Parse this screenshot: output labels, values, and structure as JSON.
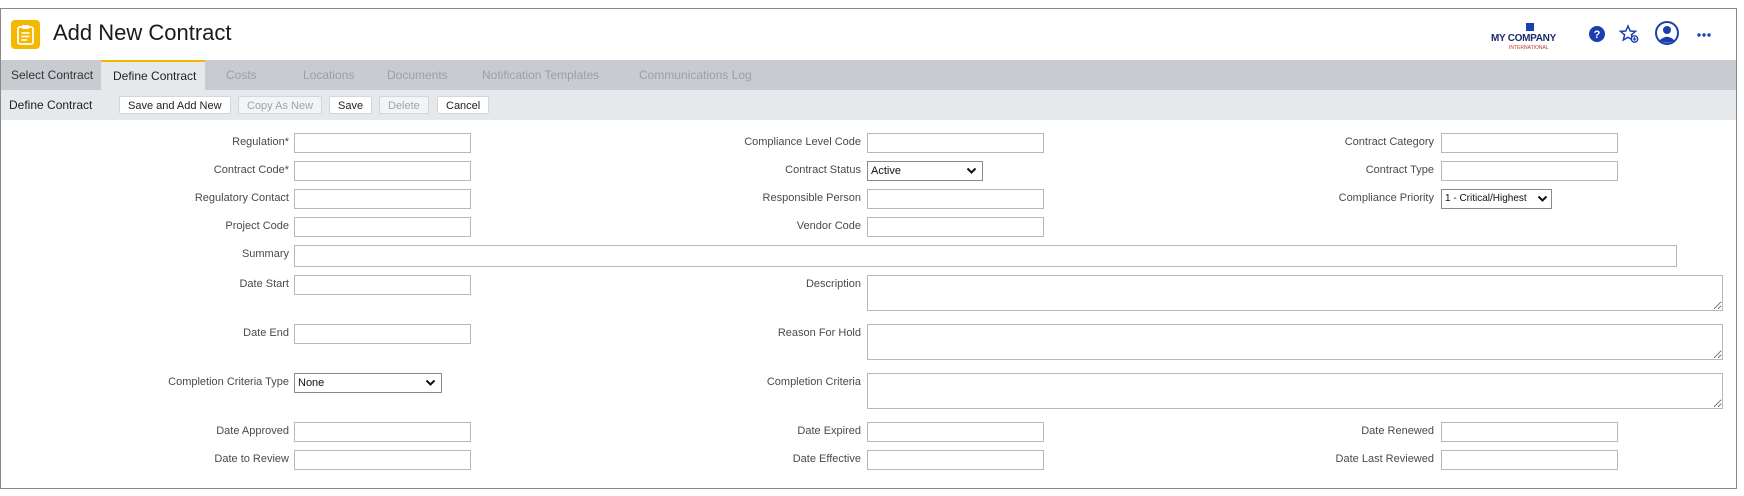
{
  "header": {
    "title": "Add New Contract",
    "app_icon": "clipboard-icon",
    "brand": {
      "name": "MY COMPANY",
      "subtitle": "INTERNATIONAL"
    },
    "icons": [
      "help-icon",
      "favorites-star-icon",
      "user-avatar-icon",
      "more-options-icon"
    ]
  },
  "tabs": [
    {
      "label": "Select Contract",
      "state": "enabled"
    },
    {
      "label": "Define Contract",
      "state": "active"
    },
    {
      "label": "Costs",
      "state": "disabled"
    },
    {
      "label": "Locations",
      "state": "disabled"
    },
    {
      "label": "Documents",
      "state": "disabled"
    },
    {
      "label": "Notification Templates",
      "state": "disabled"
    },
    {
      "label": "Communications Log",
      "state": "disabled"
    }
  ],
  "toolbar": {
    "label": "Define Contract",
    "save_and_add_new": "Save and Add New",
    "copy_as_new": "Copy As New",
    "save": "Save",
    "delete": "Delete",
    "cancel": "Cancel"
  },
  "form": {
    "regulation": {
      "label": "Regulation*",
      "value": ""
    },
    "contract_code": {
      "label": "Contract Code*",
      "value": ""
    },
    "regulatory_contact": {
      "label": "Regulatory Contact",
      "value": ""
    },
    "project_code": {
      "label": "Project Code",
      "value": ""
    },
    "summary": {
      "label": "Summary",
      "value": ""
    },
    "date_start": {
      "label": "Date Start",
      "value": ""
    },
    "date_end": {
      "label": "Date End",
      "value": ""
    },
    "completion_criteria_type": {
      "label": "Completion Criteria Type",
      "value": "None"
    },
    "date_approved": {
      "label": "Date Approved",
      "value": ""
    },
    "date_to_review": {
      "label": "Date to Review",
      "value": ""
    },
    "compliance_level_code": {
      "label": "Compliance Level Code",
      "value": ""
    },
    "contract_status": {
      "label": "Contract Status",
      "value": "Active"
    },
    "responsible_person": {
      "label": "Responsible Person",
      "value": ""
    },
    "vendor_code": {
      "label": "Vendor Code",
      "value": ""
    },
    "description": {
      "label": "Description",
      "value": ""
    },
    "reason_for_hold": {
      "label": "Reason For Hold",
      "value": ""
    },
    "completion_criteria": {
      "label": "Completion Criteria",
      "value": ""
    },
    "date_expired": {
      "label": "Date Expired",
      "value": ""
    },
    "date_effective": {
      "label": "Date Effective",
      "value": ""
    },
    "contract_category": {
      "label": "Contract Category",
      "value": ""
    },
    "contract_type": {
      "label": "Contract Type",
      "value": ""
    },
    "compliance_priority": {
      "label": "Compliance Priority",
      "value": "1 - Critical/Highest"
    },
    "date_renewed": {
      "label": "Date Renewed",
      "value": ""
    },
    "date_last_reviewed": {
      "label": "Date Last Reviewed",
      "value": ""
    }
  },
  "colors": {
    "accent": "#f5b800",
    "tab_bar": "#c8ccd1",
    "toolbar": "#e6e9ec",
    "brand_blue": "#1c2a6b",
    "icon_blue": "#1c3fb0"
  }
}
